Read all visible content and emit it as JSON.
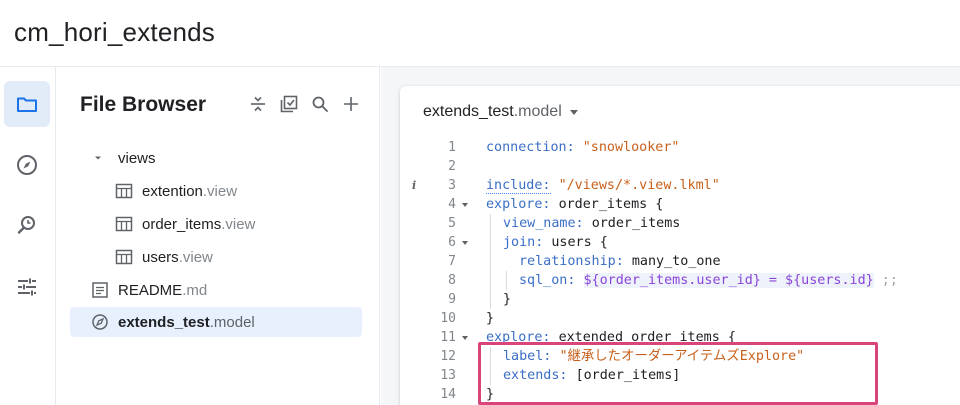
{
  "project": {
    "title": "cm_hori_extends"
  },
  "rail": {
    "items": [
      {
        "icon": "folder-icon",
        "active": true
      },
      {
        "icon": "compass-icon",
        "active": false
      },
      {
        "icon": "search-history-icon",
        "active": false
      },
      {
        "icon": "sliders-icon",
        "active": false
      }
    ]
  },
  "file_browser": {
    "title": "File Browser",
    "tools": [
      "collapse-icon",
      "checklist-icon",
      "search-icon",
      "add-icon"
    ],
    "tree": [
      {
        "name": "views",
        "ext": "",
        "type": "folder"
      },
      {
        "name": "extention",
        "ext": ".view",
        "type": "view"
      },
      {
        "name": "order_items",
        "ext": ".view",
        "type": "view"
      },
      {
        "name": "users",
        "ext": ".view",
        "type": "view"
      },
      {
        "name": "README",
        "ext": ".md",
        "type": "doc"
      },
      {
        "name": "extends_test",
        "ext": ".model",
        "type": "model",
        "selected": true
      }
    ]
  },
  "editor": {
    "tab": {
      "name": "extends_test",
      "ext": ".model"
    },
    "line_numbers": [
      "1",
      "2",
      "3",
      "4",
      "5",
      "6",
      "7",
      "8",
      "9",
      "10",
      "11",
      "12",
      "13",
      "14"
    ],
    "code": {
      "l1_key": "connection:",
      "l1_val": "\"snowlooker\"",
      "l3_key": "include:",
      "l3_val": "\"/views/*.view.lkml\"",
      "l4_key": "explore:",
      "l4_val": "order_items {",
      "l5_key": "view_name:",
      "l5_val": "order_items",
      "l6_key": "join:",
      "l6_val": "users {",
      "l7_key": "relationship:",
      "l7_val": "many_to_one",
      "l8_key": "sql_on:",
      "l8_val": "${order_items.user_id} = ${users.id}",
      "l8_tail": ";;",
      "l9": "}",
      "l10": "}",
      "l11_key": "explore:",
      "l11_val": "extended_order_items {",
      "l12_key": "label:",
      "l12_val": "\"継承したオーダーアイテムズExplore\"",
      "l13_key": "extends:",
      "l13_val": "[order_items]",
      "l14": "}"
    }
  },
  "colors": {
    "highlight": "#d9447b",
    "keyword": "#3b6fc6",
    "string": "#c9601b",
    "substitution": "#8a44d8"
  }
}
